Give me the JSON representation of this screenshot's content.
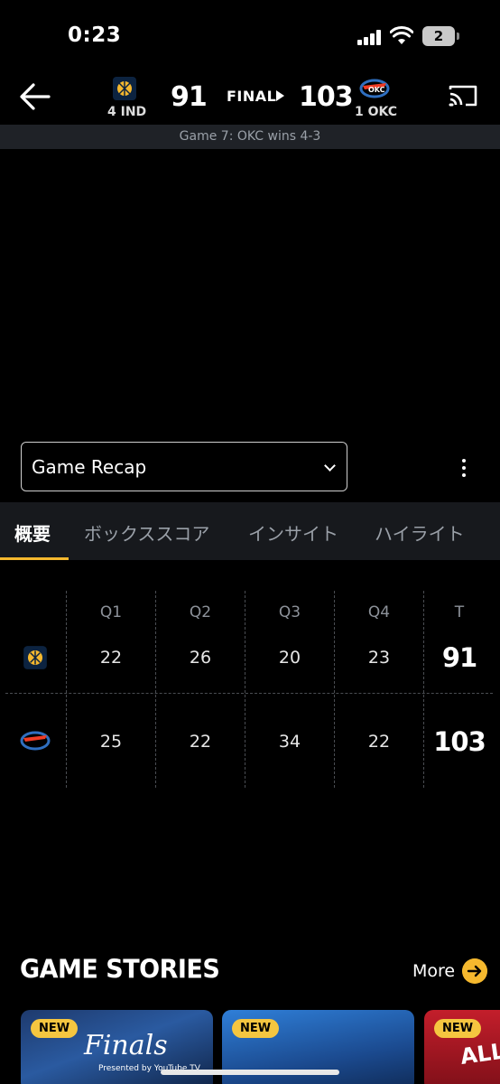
{
  "status_bar": {
    "time": "0:23",
    "battery": "2"
  },
  "header": {
    "away": {
      "seed_abbr": "4 IND",
      "score": "91",
      "logo": "pacers-logo-icon",
      "color": "#f5b82e"
    },
    "home": {
      "seed_abbr": "1 OKC",
      "score": "103",
      "logo": "thunder-logo-icon",
      "color": "#2f6fc0"
    },
    "status": "FINAL",
    "series_text": "Game 7: OKC wins 4-3"
  },
  "video": {
    "selected_option": "Game Recap"
  },
  "tabs": [
    {
      "label": "概要",
      "active": true
    },
    {
      "label": "ボックススコア",
      "active": false
    },
    {
      "label": "インサイト",
      "active": false
    },
    {
      "label": "ハイライト",
      "active": false
    }
  ],
  "linescore": {
    "headers": [
      "Q1",
      "Q2",
      "Q3",
      "Q4",
      "T"
    ],
    "rows": [
      {
        "team": "IND",
        "quarters": [
          "22",
          "26",
          "20",
          "23"
        ],
        "total": "91"
      },
      {
        "team": "OKC",
        "quarters": [
          "25",
          "22",
          "34",
          "22"
        ],
        "total": "103"
      }
    ]
  },
  "stories": {
    "title": "GAME STORIES",
    "more_label": "More",
    "cards": [
      {
        "badge": "NEW",
        "title": "Finals",
        "sponsor": "Presented by YouTube TV"
      },
      {
        "badge": "NEW"
      },
      {
        "badge": "NEW",
        "title": "ALL-"
      }
    ]
  },
  "accent_color": "#f5b82e"
}
